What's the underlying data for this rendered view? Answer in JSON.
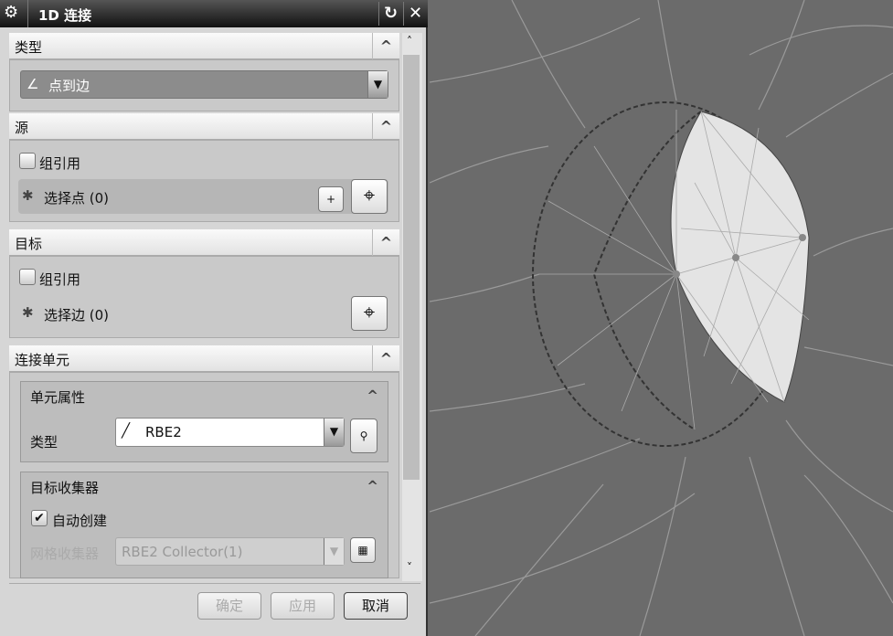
{
  "dialog": {
    "title": "1D 连接"
  },
  "type_section": {
    "header": "类型",
    "selected": "点到边"
  },
  "source_section": {
    "header": "源",
    "group_ref_label": "组引用",
    "group_ref_checked": false,
    "select_label": "选择点 (0)",
    "add_btn": "+"
  },
  "target_section": {
    "header": "目标",
    "group_ref_label": "组引用",
    "group_ref_checked": false,
    "select_label": "选择边 (0)"
  },
  "connect_section": {
    "header": "连接单元",
    "element_props": {
      "header": "单元属性",
      "type_label": "类型",
      "type_value": "RBE2"
    },
    "collector": {
      "header": "目标收集器",
      "auto_create_label": "自动创建",
      "auto_create_checked": true,
      "mesh_collector_label": "网格收集器",
      "mesh_collector_value": "RBE2 Collector(1)"
    }
  },
  "footer": {
    "ok": "确定",
    "apply": "应用",
    "cancel": "取消"
  },
  "required_marker": "✱"
}
